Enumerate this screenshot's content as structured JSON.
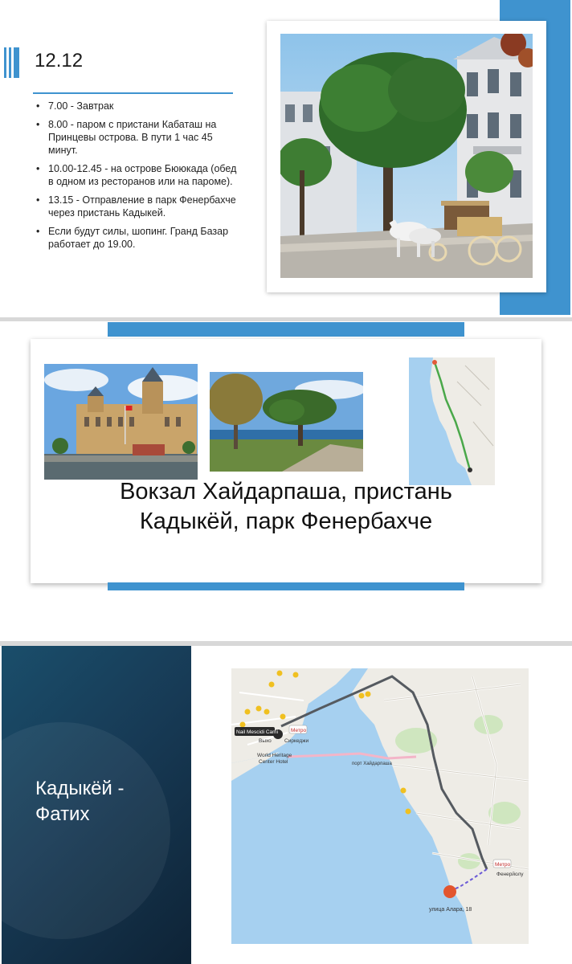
{
  "slide1": {
    "title": "12.12",
    "items": [
      "7.00 - Завтрак",
      "8.00 - паром с пристани Кабаташ на Принцевы острова. В пути 1 час 45 минут.",
      "10.00-12.45 - на острове Бююкада (обед в одном из ресторанов или на пароме).",
      "13.15 - Отправление в парк Фенербахче через пристань Кадыкей.",
      "Если будут силы, шопинг. Гранд Базар работает до 19.00."
    ]
  },
  "slide2": {
    "title_line1": "Вокзал Хайдарпаша, пристань",
    "title_line2": "Кадыкёй, парк Фенербахче"
  },
  "slide3": {
    "title_line1": "Кадыкёй -",
    "title_line2": "Фатих",
    "map_labels": {
      "hotel": "Nail Mescidi Cami",
      "metro1": "Метро",
      "sirkeci": "Сиркеджи",
      "vykh": "Выхо",
      "world1": "World Heritage",
      "world2": "Center Hotel",
      "haydarpasa": "порт Хайдарпаша",
      "metro2": "Метро",
      "fener": "Фенерйолу",
      "dest": "улица Алара, 18"
    }
  },
  "colors": {
    "accent": "#3f93cf",
    "dark_panel": "#173a55",
    "water": "#a6d0f0",
    "land": "#eeece6"
  }
}
